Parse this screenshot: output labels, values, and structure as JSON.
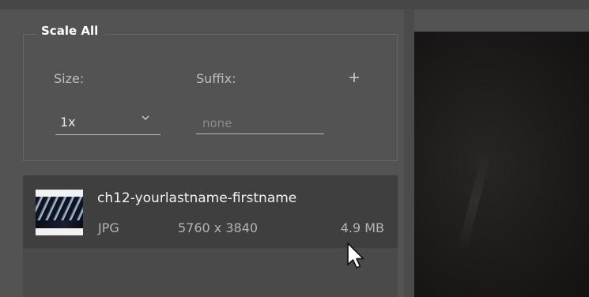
{
  "scale_all": {
    "title": "Scale All",
    "size_label": "Size:",
    "size_value": "1x",
    "suffix_label": "Suffix:",
    "suffix_placeholder": "none",
    "add_label": "+"
  },
  "files": [
    {
      "name": "ch12-yourlastname-firstname",
      "type": "JPG",
      "dimensions": "5760 x 3840",
      "size": "4.9 MB"
    }
  ],
  "icons": {
    "size_dropdown": "chevron-down-icon",
    "cursor": "mouse-pointer-icon"
  },
  "colors": {
    "panel_background": "#535353",
    "row_background": "#3f3f3f",
    "text_primary": "#f2f2f2",
    "text_secondary": "#b4b4b4"
  }
}
